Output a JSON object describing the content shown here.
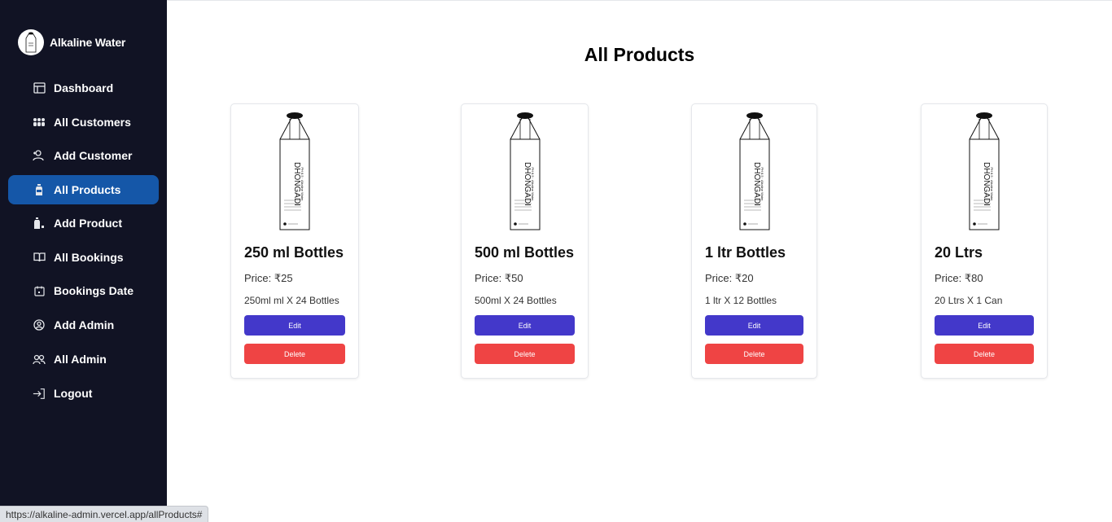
{
  "brand": {
    "name": "Alkaline Water",
    "logo_icon": "water-bottle-logo"
  },
  "sidebar": {
    "items": [
      {
        "label": "Dashboard",
        "icon": "dashboard-icon",
        "active": false
      },
      {
        "label": "All Customers",
        "icon": "people-icon",
        "active": false
      },
      {
        "label": "Add Customer",
        "icon": "add-user-icon",
        "active": false
      },
      {
        "label": "All Products",
        "icon": "bottle-icon",
        "active": true
      },
      {
        "label": "Add Product",
        "icon": "bottle-plus-icon",
        "active": false
      },
      {
        "label": "All Bookings",
        "icon": "book-icon",
        "active": false
      },
      {
        "label": "Bookings Date",
        "icon": "calendar-icon",
        "active": false
      },
      {
        "label": "Add Admin",
        "icon": "user-circle-icon",
        "active": false
      },
      {
        "label": "All Admin",
        "icon": "users-icon",
        "active": false
      },
      {
        "label": "Logout",
        "icon": "logout-icon",
        "active": false
      }
    ]
  },
  "page": {
    "title": "All Products"
  },
  "bottle_label": {
    "brand": "DHONGADI",
    "sub": "PH 8.5 · Alkaline Water"
  },
  "products": [
    {
      "name": "250 ml Bottles",
      "price": "Price: ₹25",
      "desc": "250ml ml X 24 Bottles",
      "edit_label": "Edit",
      "delete_label": "Delete"
    },
    {
      "name": "500 ml Bottles",
      "price": "Price: ₹50",
      "desc": "500ml X 24 Bottles",
      "edit_label": "Edit",
      "delete_label": "Delete"
    },
    {
      "name": "1 ltr Bottles",
      "price": "Price: ₹20",
      "desc": "1 ltr X 12 Bottles",
      "edit_label": "Edit",
      "delete_label": "Delete"
    },
    {
      "name": "20 Ltrs",
      "price": "Price: ₹80",
      "desc": "20 Ltrs X 1 Can",
      "edit_label": "Edit",
      "delete_label": "Delete"
    }
  ],
  "status_bar": {
    "url": "https://alkaline-admin.vercel.app/allProducts#"
  },
  "colors": {
    "sidebar_bg": "#111324",
    "active_item": "#1557a8",
    "edit_button": "#4338ca",
    "delete_button": "#ef4444"
  }
}
